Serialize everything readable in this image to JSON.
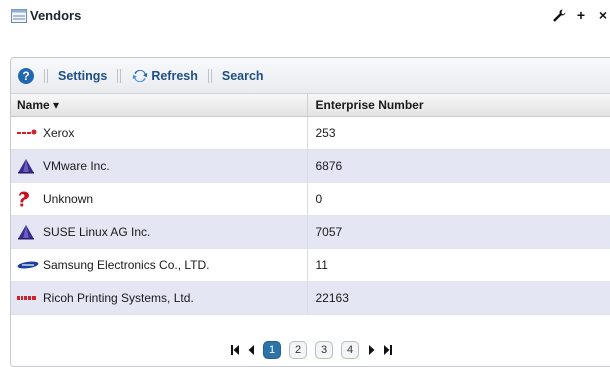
{
  "portlet": {
    "title": "Vendors",
    "tools": {
      "wrench": "wrench-icon",
      "add": "+",
      "close": "×"
    }
  },
  "toolbar": {
    "help_label": "?",
    "settings_label": "Settings",
    "refresh_label": "Refresh",
    "search_label": "Search"
  },
  "table": {
    "columns": [
      "Name ▾",
      "Enterprise Number"
    ],
    "rows": [
      {
        "name": "Xerox",
        "number": "253",
        "logo": "xerox-logo"
      },
      {
        "name": "VMware Inc.",
        "number": "6876",
        "logo": "vmware-logo"
      },
      {
        "name": "Unknown",
        "number": "0",
        "logo": "question-icon"
      },
      {
        "name": "SUSE Linux AG Inc.",
        "number": "7057",
        "logo": "suse-logo"
      },
      {
        "name": "Samsung Electronics Co., LTD.",
        "number": "11",
        "logo": "samsung-logo"
      },
      {
        "name": "Ricoh Printing Systems, Ltd.",
        "number": "22163",
        "logo": "ricoh-logo"
      }
    ]
  },
  "pager": {
    "pages": [
      "1",
      "2",
      "3",
      "4"
    ],
    "current": "1"
  },
  "colors": {
    "accent": "#1f4f86",
    "row_alt": "#e4e6f4",
    "active_page": "#2c74a8"
  }
}
